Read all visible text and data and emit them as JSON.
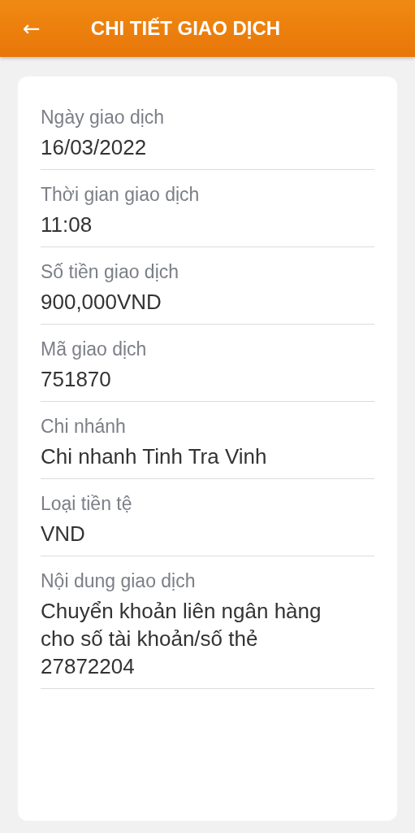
{
  "header": {
    "back": "←",
    "title": "CHI TIẾT GIAO DỊCH"
  },
  "fields": [
    {
      "label": "Ngày giao dịch",
      "value": "16/03/2022"
    },
    {
      "label": "Thời gian giao dịch",
      "value": "11:08"
    },
    {
      "label": "Số tiền giao dịch",
      "value": "900,000VND"
    },
    {
      "label": "Mã giao dịch",
      "value": "751870"
    },
    {
      "label": "Chi nhánh",
      "value": "Chi nhanh Tinh Tra Vinh"
    },
    {
      "label": "Loại tiền tệ",
      "value": "VND"
    },
    {
      "label": "Nội dung giao dịch",
      "value": "Chuyển khoản liên ngân hàng cho số tài khoản/số thẻ 27872204"
    }
  ]
}
